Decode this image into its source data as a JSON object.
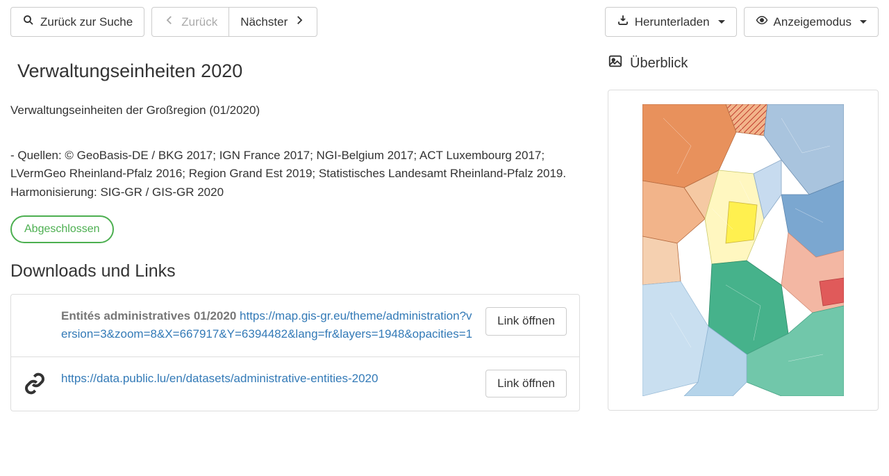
{
  "toolbar": {
    "back_to_search": "Zurück zur Suche",
    "prev": "Zurück",
    "next": "Nächster",
    "download": "Herunterladen",
    "display_mode": "Anzeigemodus"
  },
  "title": "Verwaltungseinheiten 2020",
  "description_line1": "Verwaltungseinheiten der Großregion (01/2020)",
  "description_line2": "- Quellen: © GeoBasis-DE / BKG 2017; IGN France 2017; NGI-Belgium 2017; ACT Luxembourg 2017; LVermGeo Rheinland-Pfalz 2016; Region Grand Est 2019; Statistisches Landesamt Rheinland-Pfalz 2019. Harmonisierung: SIG-GR / GIS-GR 2020",
  "status": "Abgeschlossen",
  "downloads_heading": "Downloads und Links",
  "links": [
    {
      "label": "Entités administratives 01/2020",
      "url": "https://map.gis-gr.eu/theme/administration?version=3&zoom=8&X=667917&Y=6394482&lang=fr&layers=1948&opacities=1",
      "open": "Link öffnen"
    },
    {
      "label": "",
      "url": "https://data.public.lu/en/datasets/administrative-entities-2020",
      "open": "Link öffnen"
    }
  ],
  "overview_heading": "Überblick"
}
